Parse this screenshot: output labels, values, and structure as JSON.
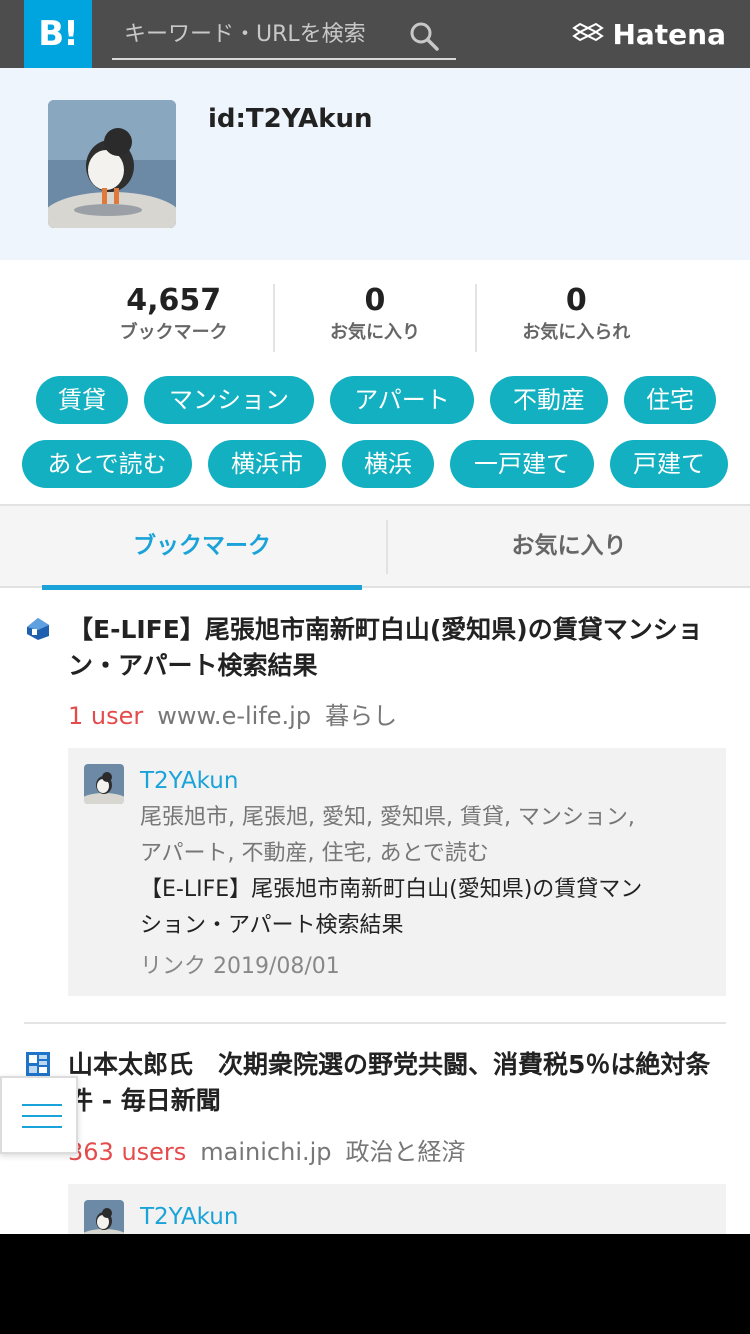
{
  "header": {
    "logo_text": "B!",
    "search_placeholder": "キーワード・URLを検索",
    "brand": "Hatena"
  },
  "profile": {
    "user_id": "id:T2YAkun"
  },
  "stats": [
    {
      "value": "4,657",
      "label": "ブックマーク"
    },
    {
      "value": "0",
      "label": "お気に入り"
    },
    {
      "value": "0",
      "label": "お気に入られ"
    }
  ],
  "tags": [
    "賃貸",
    "マンション",
    "アパート",
    "不動産",
    "住宅",
    "あとで読む",
    "横浜市",
    "横浜",
    "一戸建て",
    "戸建て"
  ],
  "tabs": {
    "bookmark": "ブックマーク",
    "favorites": "お気に入り"
  },
  "entries": [
    {
      "title": "【E-LIFE】尾張旭市南新町白山(愛知県)の賃貸マンション・アパート検索結果",
      "users": "1 user",
      "domain": "www.e-life.jp",
      "category": "暮らし",
      "icon": "house-icon",
      "comment": {
        "user": "T2YAkun",
        "tags": "尾張旭市, 尾張旭, 愛知, 愛知県, 賃貸, マンション, アパート, 不動産, 住宅, あとで読む",
        "title": "【E-LIFE】尾張旭市南新町白山(愛知県)の賃貸マンション・アパート検索結果",
        "date": "リンク 2019/08/01"
      }
    },
    {
      "title": "山本太郎氏　次期衆院選の野党共闘、消費税5％は絶対条件 - 毎日新聞",
      "users": "363 users",
      "domain": "mainichi.jp",
      "category": "政治と経済",
      "icon": "building-icon",
      "comment": {
        "user": "T2YAkun"
      }
    }
  ],
  "colors": {
    "header_bg": "#4d4d4d",
    "logo_bg": "#00a4de",
    "accent": "#1aa3d8",
    "tag_bg": "#12b0c0",
    "users_red": "#e44c4c"
  }
}
